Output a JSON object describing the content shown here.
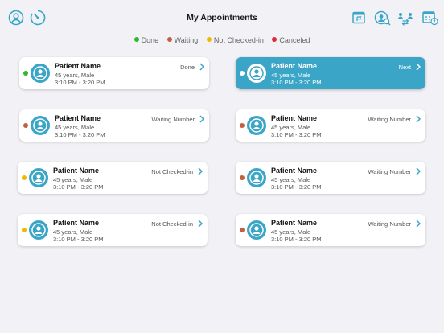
{
  "header": {
    "title": "My Appointments",
    "icons": [
      "profile-icon",
      "timer-icon",
      "calendar-flag-icon",
      "search-user-icon",
      "swap-users-icon",
      "calendar-user-icon"
    ]
  },
  "colors": {
    "accent": "#3aa5c6",
    "done": "#2eb82e",
    "waiting": "#c0613f",
    "not_checked_in": "#f2b705",
    "canceled": "#e3263d"
  },
  "legend": [
    {
      "label": "Done",
      "color": "#2eb82e"
    },
    {
      "label": "Waiting",
      "color": "#c0613f"
    },
    {
      "label": "Not Checked-in",
      "color": "#f2b705"
    },
    {
      "label": "Canceled",
      "color": "#e3263d"
    }
  ],
  "appointments": [
    {
      "name": "Patient Name",
      "details": "45 years, Male",
      "time": "3:10 PM - 3:20 PM",
      "status_text": "Done",
      "status": "done",
      "selected": false
    },
    {
      "name": "Patient Name",
      "details": "45 years, Male",
      "time": "3:10 PM - 3:20 PM",
      "status_text": "Next",
      "status": "next",
      "selected": true
    },
    {
      "name": "Patient Name",
      "details": "45 years, Male",
      "time": "3:10 PM - 3:20 PM",
      "status_text": "Waiting Number",
      "status": "waiting",
      "selected": false
    },
    {
      "name": "Patient Name",
      "details": "45 years, Male",
      "time": "3:10 PM - 3:20 PM",
      "status_text": "Waiting Number",
      "status": "waiting",
      "selected": false
    },
    {
      "name": "Patient Name",
      "details": "45 years, Male",
      "time": "3:10 PM - 3:20 PM",
      "status_text": "Not Checked-in",
      "status": "not_checked_in",
      "selected": false
    },
    {
      "name": "Patient Name",
      "details": "45 years, Male",
      "time": "3:10 PM - 3:20 PM",
      "status_text": "Waiting Number",
      "status": "waiting",
      "selected": false
    },
    {
      "name": "Patient Name",
      "details": "45 years, Male",
      "time": "3:10 PM - 3:20 PM",
      "status_text": "Not Checked-in",
      "status": "not_checked_in",
      "selected": false
    },
    {
      "name": "Patient Name",
      "details": "45 years, Male",
      "time": "3:10 PM - 3:20 PM",
      "status_text": "Waiting Number",
      "status": "waiting",
      "selected": false
    }
  ]
}
